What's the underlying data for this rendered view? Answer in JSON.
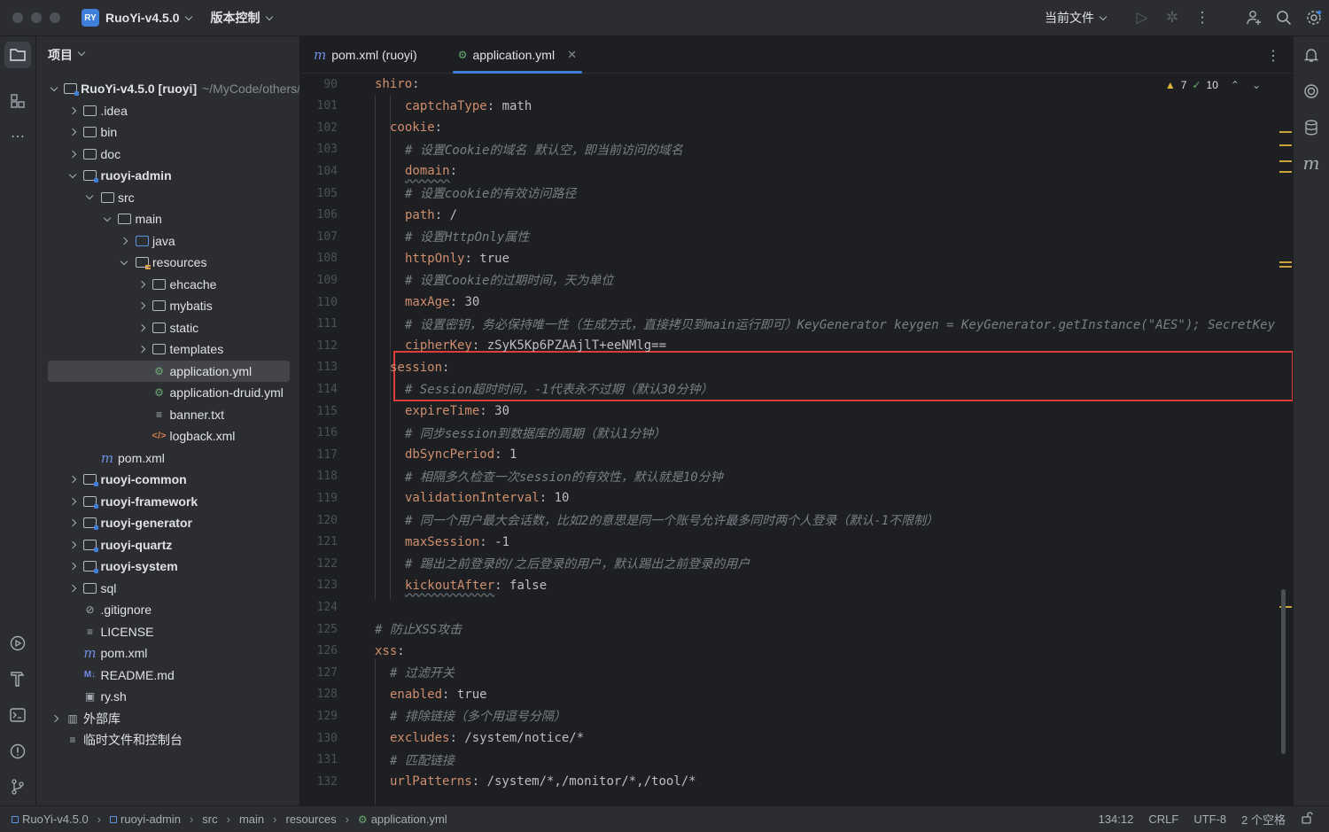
{
  "titlebar": {
    "project_badge": "RY",
    "project_name": "RuoYi-v4.5.0",
    "vcs_label": "版本控制",
    "current_file_label": "当前文件"
  },
  "project_panel": {
    "title": "项目",
    "tree": [
      {
        "label": "RuoYi-v4.5.0 [ruoyi]",
        "extra": "~/MyCode/others/",
        "depth": 0,
        "arrow": "d",
        "icon": "module-folder",
        "bold": true
      },
      {
        "label": ".idea",
        "depth": 1,
        "arrow": "r",
        "icon": "folder"
      },
      {
        "label": "bin",
        "depth": 1,
        "arrow": "r",
        "icon": "folder"
      },
      {
        "label": "doc",
        "depth": 1,
        "arrow": "r",
        "icon": "folder"
      },
      {
        "label": "ruoyi-admin",
        "depth": 1,
        "arrow": "d",
        "icon": "module-folder",
        "bold": true
      },
      {
        "label": "src",
        "depth": 2,
        "arrow": "d",
        "icon": "folder"
      },
      {
        "label": "main",
        "depth": 3,
        "arrow": "d",
        "icon": "folder"
      },
      {
        "label": "java",
        "depth": 4,
        "arrow": "r",
        "icon": "source-folder"
      },
      {
        "label": "resources",
        "depth": 4,
        "arrow": "d",
        "icon": "resource-folder"
      },
      {
        "label": "ehcache",
        "depth": 5,
        "arrow": "r",
        "icon": "folder"
      },
      {
        "label": "mybatis",
        "depth": 5,
        "arrow": "r",
        "icon": "folder"
      },
      {
        "label": "static",
        "depth": 5,
        "arrow": "r",
        "icon": "folder"
      },
      {
        "label": "templates",
        "depth": 5,
        "arrow": "r",
        "icon": "folder"
      },
      {
        "label": "application.yml",
        "depth": 5,
        "arrow": "n",
        "icon": "yml",
        "selected": true
      },
      {
        "label": "application-druid.yml",
        "depth": 5,
        "arrow": "n",
        "icon": "yml"
      },
      {
        "label": "banner.txt",
        "depth": 5,
        "arrow": "n",
        "icon": "text"
      },
      {
        "label": "logback.xml",
        "depth": 5,
        "arrow": "n",
        "icon": "xml"
      },
      {
        "label": "pom.xml",
        "depth": 2,
        "arrow": "n",
        "icon": "maven"
      },
      {
        "label": "ruoyi-common",
        "depth": 1,
        "arrow": "r",
        "icon": "module-folder",
        "bold": true
      },
      {
        "label": "ruoyi-framework",
        "depth": 1,
        "arrow": "r",
        "icon": "module-folder",
        "bold": true
      },
      {
        "label": "ruoyi-generator",
        "depth": 1,
        "arrow": "r",
        "icon": "module-folder",
        "bold": true
      },
      {
        "label": "ruoyi-quartz",
        "depth": 1,
        "arrow": "r",
        "icon": "module-folder",
        "bold": true
      },
      {
        "label": "ruoyi-system",
        "depth": 1,
        "arrow": "r",
        "icon": "module-folder",
        "bold": true
      },
      {
        "label": "sql",
        "depth": 1,
        "arrow": "r",
        "icon": "folder"
      },
      {
        "label": ".gitignore",
        "depth": 1,
        "arrow": "n",
        "icon": "ignore"
      },
      {
        "label": "LICENSE",
        "depth": 1,
        "arrow": "n",
        "icon": "text"
      },
      {
        "label": "pom.xml",
        "depth": 1,
        "arrow": "n",
        "icon": "maven"
      },
      {
        "label": "README.md",
        "depth": 1,
        "arrow": "n",
        "icon": "markdown"
      },
      {
        "label": "ry.sh",
        "depth": 1,
        "arrow": "n",
        "icon": "shell"
      },
      {
        "label": "外部库",
        "depth": 0,
        "arrow": "r",
        "icon": "library"
      },
      {
        "label": "临时文件和控制台",
        "depth": 0,
        "arrow": "n",
        "icon": "scratch"
      }
    ]
  },
  "tabs": [
    {
      "label": "pom.xml (ruoyi)",
      "icon": "maven"
    },
    {
      "label": "application.yml",
      "icon": "yml",
      "active": true
    }
  ],
  "inspections": {
    "warnings": "7",
    "weak_warnings": "10"
  },
  "code_lines": [
    {
      "n": "90",
      "indent": 0,
      "parts": [
        [
          "k",
          "shiro"
        ],
        [
          "p",
          ":"
        ]
      ]
    },
    {
      "n": "101",
      "indent": 2,
      "parts": [
        [
          "k",
          "captchaType"
        ],
        [
          "p",
          ": "
        ],
        [
          "v",
          "math"
        ]
      ]
    },
    {
      "n": "102",
      "indent": 1,
      "parts": [
        [
          "k",
          "cookie"
        ],
        [
          "p",
          ":"
        ]
      ]
    },
    {
      "n": "103",
      "indent": 2,
      "parts": [
        [
          "c",
          "# 设置Cookie的域名 默认空，即当前访问的域名"
        ]
      ]
    },
    {
      "n": "104",
      "indent": 2,
      "parts": [
        [
          "ku",
          "domain"
        ],
        [
          "p",
          ":"
        ]
      ]
    },
    {
      "n": "105",
      "indent": 2,
      "parts": [
        [
          "c",
          "# 设置cookie的有效访问路径"
        ]
      ]
    },
    {
      "n": "106",
      "indent": 2,
      "parts": [
        [
          "k",
          "path"
        ],
        [
          "p",
          ": "
        ],
        [
          "v",
          "/"
        ]
      ]
    },
    {
      "n": "107",
      "indent": 2,
      "parts": [
        [
          "c",
          "# 设置HttpOnly属性"
        ]
      ]
    },
    {
      "n": "108",
      "indent": 2,
      "parts": [
        [
          "k",
          "httpOnly"
        ],
        [
          "p",
          ": "
        ],
        [
          "v",
          "true"
        ]
      ]
    },
    {
      "n": "109",
      "indent": 2,
      "parts": [
        [
          "c",
          "# 设置Cookie的过期时间，天为单位"
        ]
      ]
    },
    {
      "n": "110",
      "indent": 2,
      "parts": [
        [
          "k",
          "maxAge"
        ],
        [
          "p",
          ": "
        ],
        [
          "v",
          "30"
        ]
      ]
    },
    {
      "n": "111",
      "indent": 2,
      "parts": [
        [
          "c",
          "# 设置密钥，务必保持唯一性（生成方式，直接拷贝到main运行即可）KeyGenerator keygen = KeyGenerator.getInstance(\"AES\"); SecretKey"
        ]
      ]
    },
    {
      "n": "112",
      "indent": 2,
      "parts": [
        [
          "k",
          "cipherKey"
        ],
        [
          "p",
          ": "
        ],
        [
          "v",
          "zSyK5Kp6PZAAjlT+eeNMlg=="
        ]
      ]
    },
    {
      "n": "113",
      "indent": 1,
      "parts": [
        [
          "k",
          "session"
        ],
        [
          "p",
          ":"
        ]
      ]
    },
    {
      "n": "114",
      "indent": 2,
      "parts": [
        [
          "c",
          "# Session超时时间，-1代表永不过期（默认30分钟）"
        ]
      ]
    },
    {
      "n": "115",
      "indent": 2,
      "parts": [
        [
          "k",
          "expireTime"
        ],
        [
          "p",
          ": "
        ],
        [
          "v",
          "30"
        ]
      ]
    },
    {
      "n": "116",
      "indent": 2,
      "parts": [
        [
          "c",
          "# 同步session到数据库的周期（默认1分钟）"
        ]
      ]
    },
    {
      "n": "117",
      "indent": 2,
      "parts": [
        [
          "k",
          "dbSyncPeriod"
        ],
        [
          "p",
          ": "
        ],
        [
          "v",
          "1"
        ]
      ]
    },
    {
      "n": "118",
      "indent": 2,
      "parts": [
        [
          "c",
          "# 相隔多久检查一次session的有效性，默认就是10分钟"
        ]
      ]
    },
    {
      "n": "119",
      "indent": 2,
      "parts": [
        [
          "k",
          "validationInterval"
        ],
        [
          "p",
          ": "
        ],
        [
          "v",
          "10"
        ]
      ]
    },
    {
      "n": "120",
      "indent": 2,
      "parts": [
        [
          "c",
          "# 同一个用户最大会话数，比如2的意思是同一个账号允许最多同时两个人登录（默认-1不限制）"
        ]
      ]
    },
    {
      "n": "121",
      "indent": 2,
      "parts": [
        [
          "k",
          "maxSession"
        ],
        [
          "p",
          ": "
        ],
        [
          "v",
          "-1"
        ]
      ]
    },
    {
      "n": "122",
      "indent": 2,
      "parts": [
        [
          "c",
          "# 踢出之前登录的/之后登录的用户，默认踢出之前登录的用户"
        ]
      ]
    },
    {
      "n": "123",
      "indent": 2,
      "parts": [
        [
          "ku",
          "kickoutAfter"
        ],
        [
          "p",
          ": "
        ],
        [
          "v",
          "false"
        ]
      ]
    },
    {
      "n": "124",
      "indent": 0,
      "parts": []
    },
    {
      "n": "125",
      "indent": 0,
      "parts": [
        [
          "c",
          "# 防止XSS攻击"
        ]
      ]
    },
    {
      "n": "126",
      "indent": 0,
      "parts": [
        [
          "k",
          "xss"
        ],
        [
          "p",
          ":"
        ]
      ]
    },
    {
      "n": "127",
      "indent": 1,
      "parts": [
        [
          "c",
          "# 过滤开关"
        ]
      ]
    },
    {
      "n": "128",
      "indent": 1,
      "parts": [
        [
          "k",
          "enabled"
        ],
        [
          "p",
          ": "
        ],
        [
          "v",
          "true"
        ]
      ]
    },
    {
      "n": "129",
      "indent": 1,
      "parts": [
        [
          "c",
          "# 排除链接（多个用逗号分隔）"
        ]
      ]
    },
    {
      "n": "130",
      "indent": 1,
      "parts": [
        [
          "k",
          "excludes"
        ],
        [
          "p",
          ": "
        ],
        [
          "v",
          "/system/notice/*"
        ]
      ]
    },
    {
      "n": "131",
      "indent": 1,
      "parts": [
        [
          "c",
          "# 匹配链接"
        ]
      ]
    },
    {
      "n": "132",
      "indent": 1,
      "parts": [
        [
          "k",
          "urlPatterns"
        ],
        [
          "p",
          ": "
        ],
        [
          "v",
          "/system/*,/monitor/*,/tool/*"
        ]
      ]
    }
  ],
  "statusbar": {
    "breadcrumbs": [
      "RuoYi-v4.5.0",
      "ruoyi-admin",
      "src",
      "main",
      "resources",
      "application.yml"
    ],
    "position": "134:12",
    "line_sep": "CRLF",
    "encoding": "UTF-8",
    "indent": "2 个空格"
  },
  "colors": {
    "accent": "#3d7fd9",
    "highlight_box": "#e03b3b",
    "key": "#cf8e6d",
    "comment": "#7a7e85"
  }
}
